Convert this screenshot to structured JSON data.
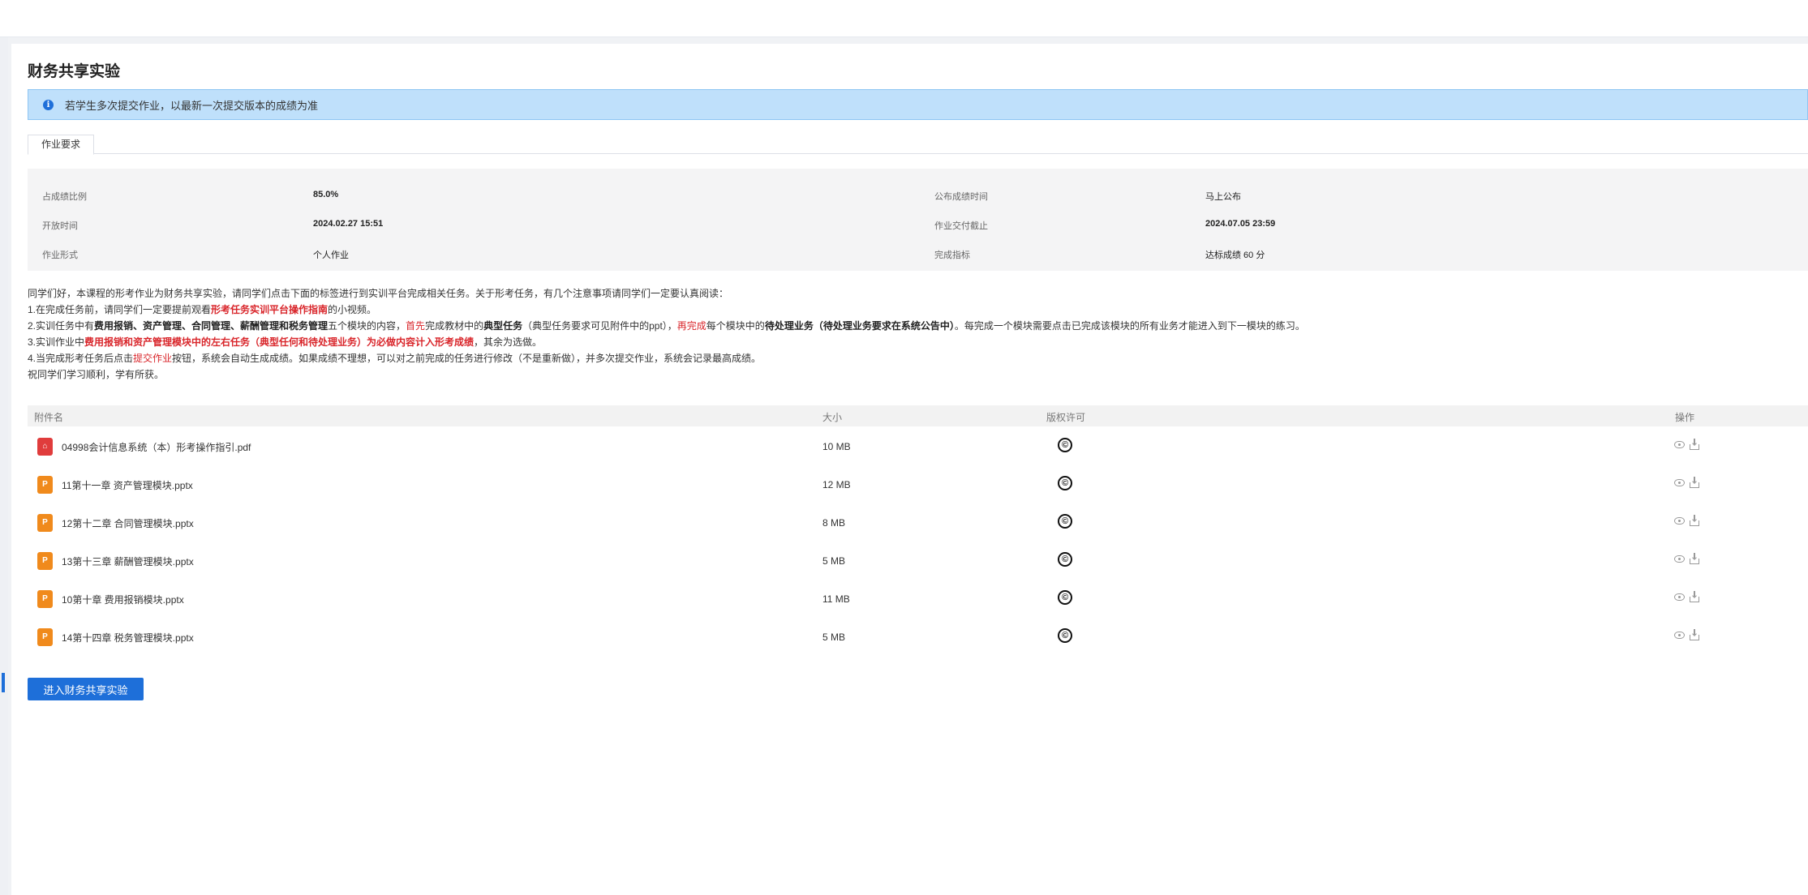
{
  "page": {
    "title": "财务共享实验",
    "notice": "若学生多次提交作业，以最新一次提交版本的成绩为准",
    "tabs": [
      {
        "label": "作业要求"
      }
    ]
  },
  "info": {
    "score_ratio_label": "占成绩比例",
    "score_ratio_value": "85.0%",
    "publish_label": "公布成绩时间",
    "publish_value": "马上公布",
    "open_label": "开放时间",
    "open_value": "2024.02.27 15:51",
    "deadline_label": "作业交付截止",
    "deadline_value": "2024.07.05 23:59",
    "form_label": "作业形式",
    "form_value": "个人作业",
    "target_label": "完成指标",
    "target_value": "达标成绩 60 分"
  },
  "description": {
    "line0": "同学们好，本课程的形考作业为财务共享实验，请同学们点击下面的标签进行到实训平台完成相关任务。关于形考任务，有几个注意事项请同学们一定要认真阅读：",
    "line1_a": "1.在完成任务前，请同学们一定要提前观看",
    "line1_b": "形考任务实训平台操作指南",
    "line1_c": "的小视频。",
    "line2_a": "2.实训任务中有",
    "line2_b": "费用报销、资产管理、合同管理、薪酬管理和税务管理",
    "line2_c": "五个模块的内容，",
    "line2_d": "首先",
    "line2_e": "完成教材中的",
    "line2_f": "典型任务",
    "line2_g": "（典型任务要求可见附件中的ppt），",
    "line2_h": "再完成",
    "line2_i": "每个模块中的",
    "line2_j": "待处理业务（待处理业务要求在系统公告中）",
    "line2_k": "。每完成一个模块需要点击已完成该模块的所有业务才能进入到下一模块的练习。",
    "line3_a": "3.实训作业中",
    "line3_b": "费用报销和资产管理模块中的左右任务（典型任何和待处理业务）为必做内容计入形考成绩",
    "line3_c": "，其余为选做。",
    "line4_a": "4.当完成形考任务后点击",
    "line4_b": "提交作业",
    "line4_c": "按钮，系统会自动生成成绩。如果成绩不理想，可以对之前完成的任务进行修改（不是重新做），并多次提交作业，系统会记录最高成绩。",
    "line5": "祝同学们学习顺利，学有所获。"
  },
  "attachments": {
    "headers": {
      "name": "附件名",
      "size": "大小",
      "license": "版权许可",
      "ops": "操作"
    },
    "license_symbol": "©",
    "rows": [
      {
        "name": "04998会计信息系统（本）形考操作指引.pdf",
        "size": "10 MB",
        "type": "pdf-icon"
      },
      {
        "name": "11第十一章 资产管理模块.pptx",
        "size": "12 MB",
        "type": "ppt-icon"
      },
      {
        "name": "12第十二章 合同管理模块.pptx",
        "size": "8 MB",
        "type": "ppt-icon"
      },
      {
        "name": "13第十三章 薪酬管理模块.pptx",
        "size": "5 MB",
        "type": "ppt-icon"
      },
      {
        "name": "10第十章 费用报销模块.pptx",
        "size": "11 MB",
        "type": "ppt-icon"
      },
      {
        "name": "14第十四章 税务管理模块.pptx",
        "size": "5 MB",
        "type": "ppt-icon"
      }
    ]
  },
  "actions": {
    "enter_button": "进入财务共享实验"
  },
  "colors": {
    "primary": "#1e6fd9",
    "notice_bg": "#bfe0fb",
    "emphasis_red": "#d9262b"
  }
}
